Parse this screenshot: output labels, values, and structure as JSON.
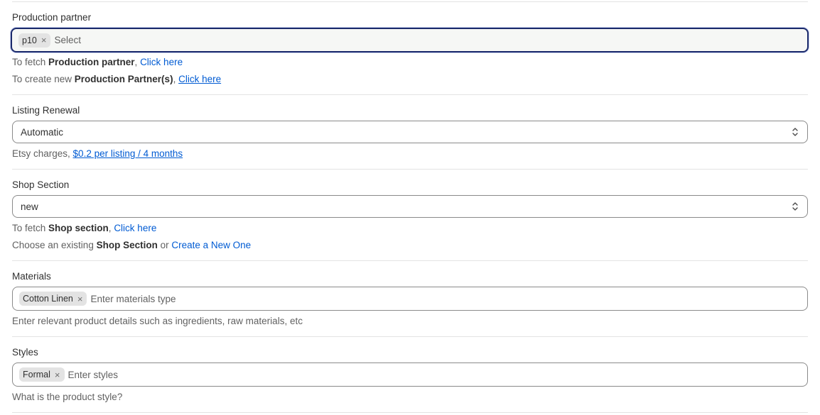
{
  "production_partner": {
    "label": "Production partner",
    "tag": "p10",
    "placeholder": "Select",
    "help1": {
      "prefix": "To fetch ",
      "bold": "Production partner",
      "sep": ", ",
      "link": "Click here"
    },
    "help2": {
      "prefix": "To create new ",
      "bold": "Production Partner(s)",
      "sep": ", ",
      "link": "Click here"
    }
  },
  "listing_renewal": {
    "label": "Listing Renewal",
    "value": "Automatic",
    "help": {
      "prefix": "Etsy charges, ",
      "link": "$0.2 per listing / 4 months"
    }
  },
  "shop_section": {
    "label": "Shop Section",
    "value": "new",
    "help1": {
      "prefix": "To fetch ",
      "bold": "Shop section",
      "sep": ", ",
      "link": "Click here"
    },
    "help2": {
      "prefix": "Choose an existing ",
      "bold": "Shop Section",
      "sep": " or ",
      "link": "Create a New One"
    }
  },
  "materials": {
    "label": "Materials",
    "tag": "Cotton Linen",
    "placeholder": "Enter materials type",
    "help": "Enter relevant product details such as ingredients, raw materials, etc"
  },
  "styles": {
    "label": "Styles",
    "tag": "Formal",
    "placeholder": "Enter styles",
    "help": "What is the product style?"
  },
  "icons": {
    "tag_remove": "close-icon",
    "select_chevron": "chevron-up-down-icon"
  },
  "colors": {
    "link": "#005bd3",
    "focus_border": "#1b2a6b",
    "tag_bg": "#e3e3e3"
  }
}
